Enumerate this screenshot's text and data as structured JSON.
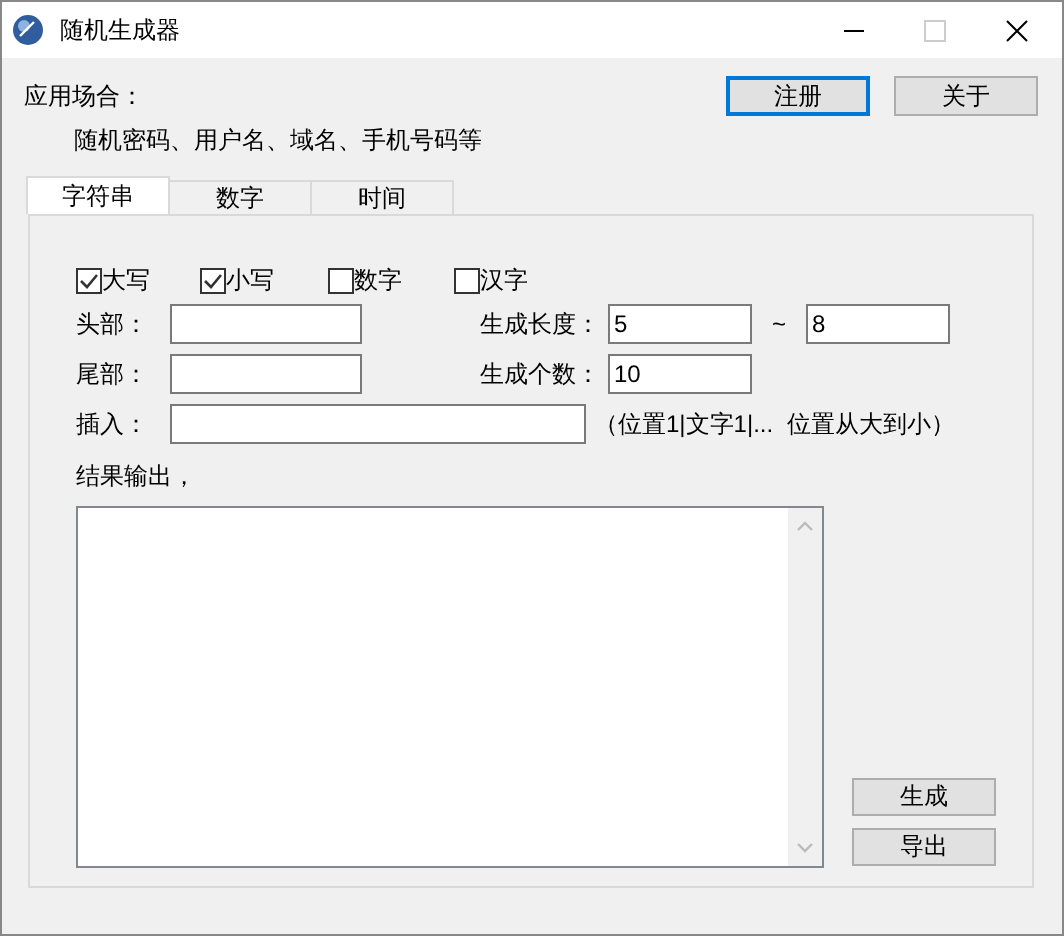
{
  "window": {
    "title": "随机生成器"
  },
  "usage": {
    "label": "应用场合：",
    "text": "随机密码、用户名、域名、手机号码等"
  },
  "top_buttons": [
    {
      "label": "注册",
      "focused": true
    },
    {
      "label": "关于",
      "focused": false
    }
  ],
  "tabs": [
    {
      "label": "字符串",
      "selected": true
    },
    {
      "label": "数字",
      "selected": false
    },
    {
      "label": "时间",
      "selected": false
    }
  ],
  "options": [
    {
      "label": "大写",
      "checked": true
    },
    {
      "label": "小写",
      "checked": true
    },
    {
      "label": "数字",
      "checked": false
    },
    {
      "label": "汉字",
      "checked": false
    }
  ],
  "head": {
    "label": "头部："
  },
  "tail": {
    "label": "尾部："
  },
  "length": {
    "label": "生成长度：",
    "min": "5",
    "separator": "~",
    "max": "8"
  },
  "count": {
    "label": "生成个数：",
    "value": "10"
  },
  "insert": {
    "label": "插入：",
    "hint": "（位置1|文字1|...  位置从大到小）"
  },
  "output": {
    "label": "结果输出，"
  },
  "action_buttons": [
    "生成",
    "导出"
  ]
}
